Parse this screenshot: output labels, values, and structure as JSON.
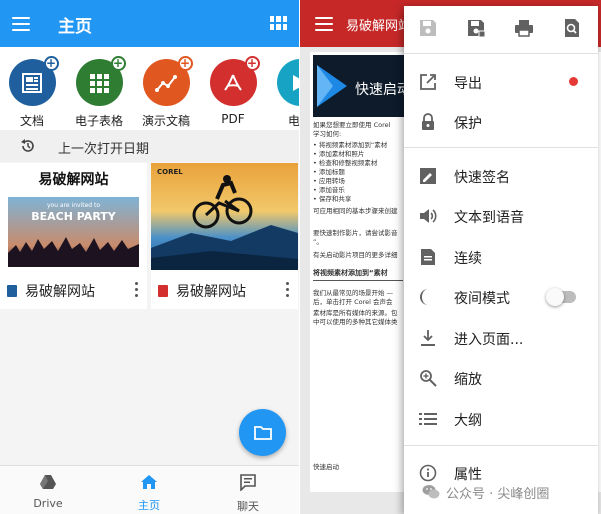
{
  "left": {
    "title": "主页",
    "doc_types": [
      {
        "label": "文档",
        "color": "#1f5f9e",
        "icon": "document-icon"
      },
      {
        "label": "电子表格",
        "color": "#2e7d32",
        "icon": "spreadsheet-icon"
      },
      {
        "label": "演示文稿",
        "color": "#e0571f",
        "icon": "presentation-icon"
      },
      {
        "label": "PDF",
        "color": "#d32f2f",
        "icon": "pdf-icon"
      },
      {
        "label": "电子",
        "color": "#17a3c4",
        "icon": "ebook-icon"
      }
    ],
    "recent_label": "上一次打开日期",
    "cards": [
      {
        "name": "易破解网站",
        "type_icon": "document-file-icon",
        "type_color": "#1f5f9e",
        "thumb_title": "易破解网站",
        "thumb_banner": "BEACH PARTY",
        "thumb_sub": "you are invited to"
      },
      {
        "name": "易破解网站",
        "type_icon": "pdf-file-icon",
        "type_color": "#d32f2f",
        "thumb_logo": "COREL"
      }
    ],
    "nav": [
      {
        "label": "Drive",
        "icon": "drive-icon"
      },
      {
        "label": "主页",
        "icon": "home-icon"
      },
      {
        "label": "聊天",
        "icon": "chat-icon"
      }
    ],
    "accent": "#2196f3"
  },
  "right": {
    "title": "易破解网站",
    "accent": "#c62828",
    "page": {
      "banner_text": "快速启动",
      "lines": [
        "如果您想要立即使用 Corel",
        "学习如何:",
        "• 将视频素材添加到“素材",
        "• 添加素材和照片",
        "• 检查和修整视频素材",
        "• 添加标题",
        "• 应用转场",
        "• 添加音乐",
        "• 保存和共享",
        "可应用相同的基本步骤来创建",
        "",
        "要快速制作影片，请尝试影音",
        "”。",
        "",
        "有关启动影片项目的更多详细"
      ],
      "section_heading": "将视频素材添加到“素材",
      "lines2": [
        "我们从最常见的场景开始 —",
        "后，单击打开 Corel  会声会",
        "素材库是所有媒体的来源。包",
        "中可以使用的多种其它媒体类"
      ],
      "footer": "快速启动"
    },
    "toolbar_icons": [
      "save-icon",
      "save-as-icon",
      "print-icon",
      "find-icon"
    ],
    "menu": [
      {
        "label": "导出",
        "icon": "export-icon",
        "badge": true
      },
      {
        "label": "保护",
        "icon": "lock-icon"
      },
      {
        "label": "快速签名",
        "icon": "signature-icon"
      },
      {
        "label": "文本到语音",
        "icon": "speaker-icon"
      },
      {
        "label": "连续",
        "icon": "continuous-page-icon"
      },
      {
        "label": "夜间模式",
        "icon": "night-mode-icon",
        "toggle": false
      },
      {
        "label": "进入页面...",
        "icon": "go-to-page-icon"
      },
      {
        "label": "缩放",
        "icon": "zoom-icon"
      },
      {
        "label": "大纲",
        "icon": "outline-icon"
      },
      {
        "label": "属性",
        "icon": "info-icon"
      }
    ]
  },
  "watermark": "公众号 · 尖峰创圈"
}
